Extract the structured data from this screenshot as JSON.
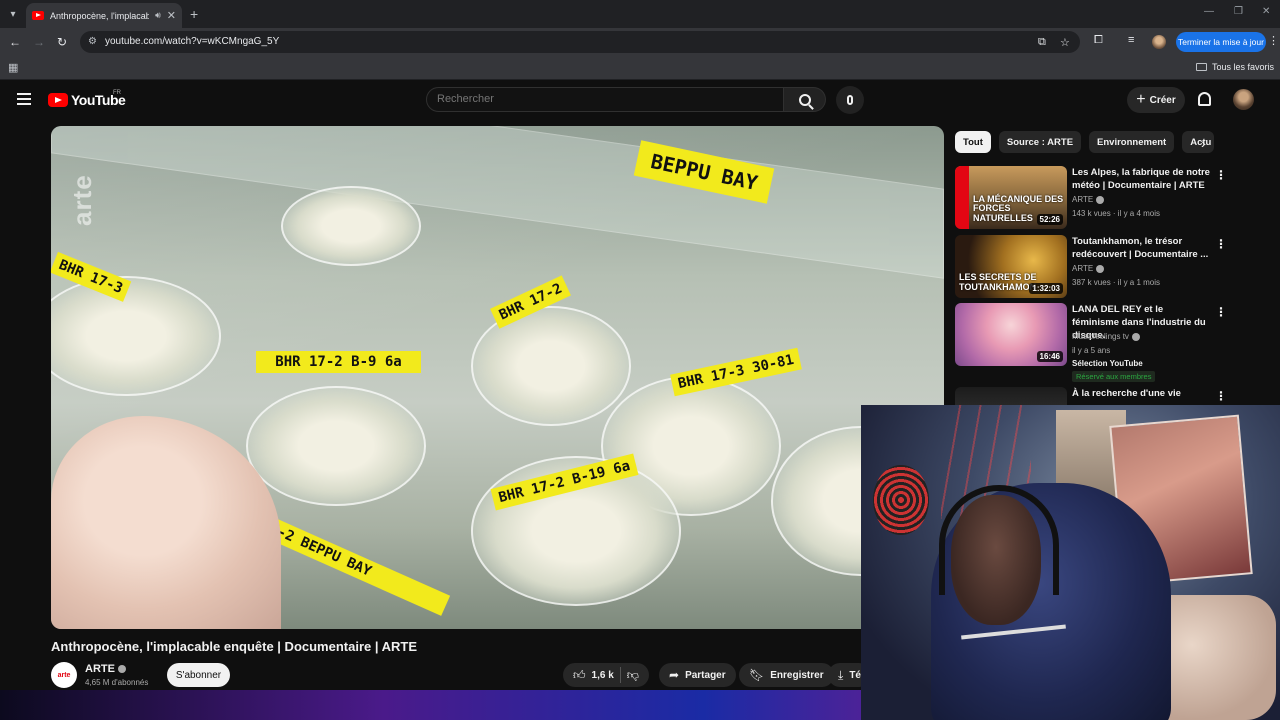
{
  "browser": {
    "tab_title": "Anthropocène, l'implacable",
    "url": "youtube.com/watch?v=wKCMngaG_5Y",
    "update_button": "Terminer la mise à jour",
    "bookmarks_folder": "Tous les favoris"
  },
  "youtube": {
    "logo_text": "YouTube",
    "country_code": "FR",
    "search_placeholder": "Rechercher",
    "create_label": "Créer"
  },
  "video": {
    "title": "Anthropocène, l'implacable enquête | Documentaire | ARTE",
    "watermark": "arte",
    "labels": [
      "BEPPU BAY",
      "BHR 17-2 B-9 6a",
      "BHR 17-3 30-81",
      "BHR 17-2",
      "BHR 17-3",
      "BHR 17-2 B-19 6a",
      "BHR 17-2 BEPPU BAY"
    ],
    "channel": {
      "name": "ARTE",
      "avatar_text": "arte",
      "subscribers": "4,65 M d'abonnés",
      "subscribe_label": "S'abonner"
    },
    "actions": {
      "likes": "1,6 k",
      "share": "Partager",
      "save": "Enregistrer",
      "download": "Té"
    }
  },
  "sidebar": {
    "chips": [
      "Tout",
      "Source : ARTE",
      "Environnement",
      "Actu"
    ],
    "recommendations": [
      {
        "title": "Les Alpes, la fabrique de notre météo | Documentaire | ARTE",
        "channel": "ARTE",
        "meta": "143 k vues · il y a 4 mois",
        "duration": "52:26",
        "thumb_text": "LA MÉCANIQUE DES FORCES NATURELLES"
      },
      {
        "title": "Toutankhamon, le trésor redécouvert | Documentaire ...",
        "channel": "ARTE",
        "meta": "387 k vues · il y a 1 mois",
        "duration": "1:32:03",
        "thumb_text": "LES SECRETS DE TOUTANKHAMON"
      },
      {
        "title": "LANA DEL REY et le féminisme dans l'industrie du disque.",
        "channel": "Musicfeelings tv",
        "meta": "il y a 5 ans",
        "duration": "16:46",
        "selection": "Sélection YouTube",
        "badge": "Réservé aux membres"
      },
      {
        "title": "À la recherche d'une vie",
        "channel": "",
        "meta": ""
      }
    ]
  },
  "colors": {
    "background": "#0f0f0f",
    "youtube_red": "#ff0000",
    "chrome_blue": "#1a73e8",
    "label_yellow": "#f2ea1c"
  }
}
